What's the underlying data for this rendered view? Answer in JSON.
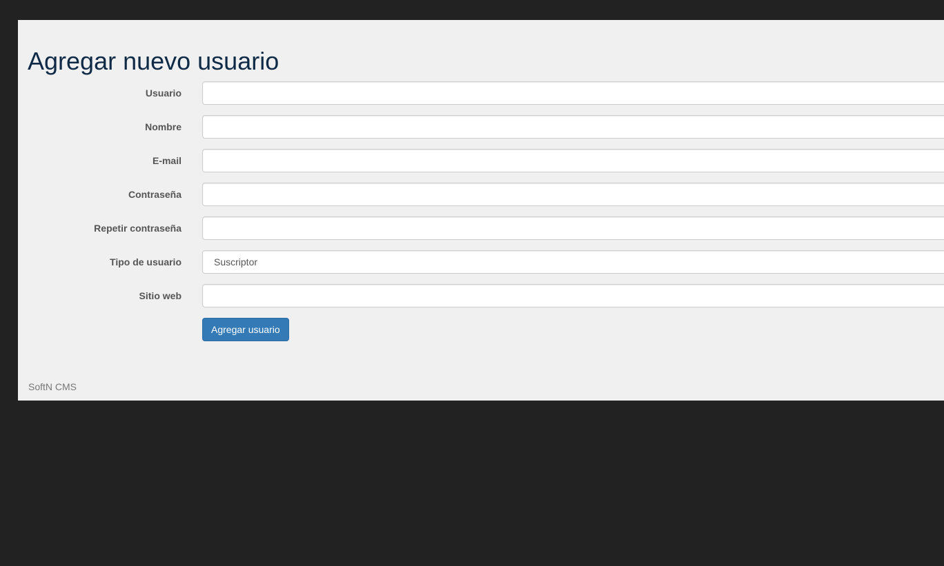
{
  "page": {
    "title": "Agregar nuevo usuario"
  },
  "form": {
    "fields": [
      {
        "label": "Usuario",
        "value": ""
      },
      {
        "label": "Nombre",
        "value": ""
      },
      {
        "label": "E-mail",
        "value": ""
      },
      {
        "label": "Contraseña",
        "value": ""
      },
      {
        "label": "Repetir contraseña",
        "value": ""
      },
      {
        "label": "Tipo de usuario",
        "value": "Suscriptor"
      },
      {
        "label": "Sitio web",
        "value": ""
      }
    ],
    "submit_label": "Agregar usuario"
  },
  "footer": {
    "text": "SoftN CMS"
  },
  "colors": {
    "background": "#222222",
    "panel": "#f0f0f0",
    "title": "#0f2a47",
    "primary_button": "#337ab7"
  }
}
